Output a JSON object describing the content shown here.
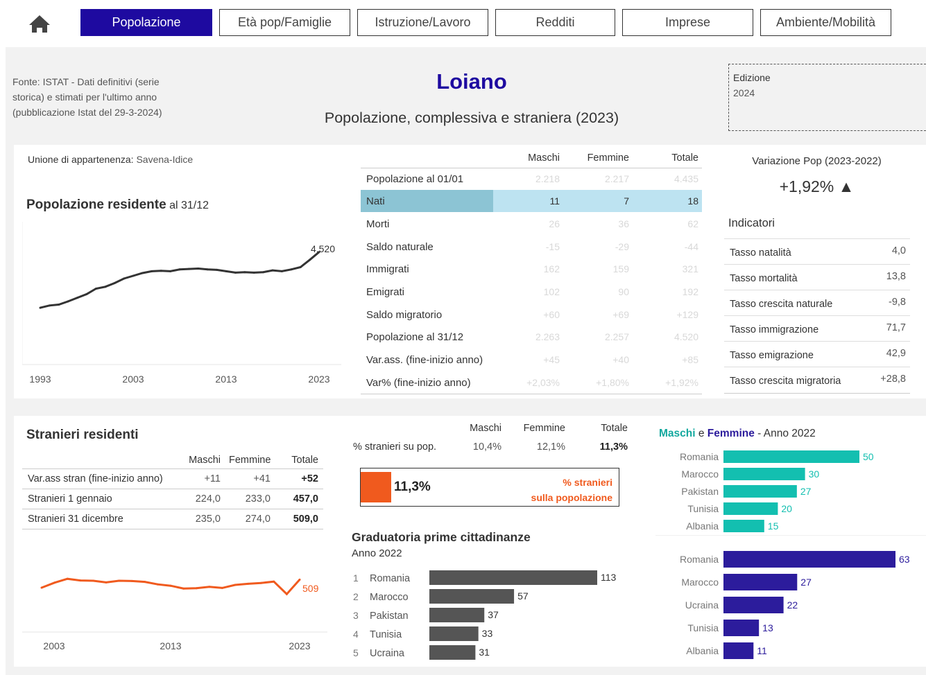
{
  "nav": {
    "tabs": [
      {
        "label": "Popolazione",
        "active": true
      },
      {
        "label": "Età pop/Famiglie"
      },
      {
        "label": "Istruzione/Lavoro"
      },
      {
        "label": "Redditi"
      },
      {
        "label": "Imprese"
      },
      {
        "label": "Ambiente/Mobilità"
      }
    ],
    "home_icon": "home-icon"
  },
  "header": {
    "source": "Fonte: ISTAT - Dati definitivi (serie storica) e stimati per l'ultimo anno (pubblicazione Istat del 29-3-2024)",
    "title": "Loiano",
    "subtitle": "Popolazione, complessiva e straniera (2023)",
    "edition_label": "Edizione",
    "edition_value": "2024"
  },
  "union": {
    "label": "Unione di appartenenza:",
    "value": "Savena-Idice"
  },
  "pop_chart": {
    "title_bold": "Popolazione residente",
    "title_light": " al 31/12",
    "end_label": "4.520",
    "ticks": [
      "1993",
      "2003",
      "2013",
      "2023"
    ]
  },
  "main_table": {
    "headers": [
      "Maschi",
      "Femmine",
      "Totale"
    ],
    "rows": [
      {
        "label": "Popolazione al 01/01",
        "m": "2.218",
        "f": "2.217",
        "t": "4.435"
      },
      {
        "label": "Nati",
        "m": "11",
        "f": "7",
        "t": "18",
        "highlight": true
      },
      {
        "label": "Morti",
        "m": "26",
        "f": "36",
        "t": "62"
      },
      {
        "label": "Saldo naturale",
        "m": "-15",
        "f": "-29",
        "t": "-44"
      },
      {
        "label": "Immigrati",
        "m": "162",
        "f": "159",
        "t": "321"
      },
      {
        "label": "Emigrati",
        "m": "102",
        "f": "90",
        "t": "192"
      },
      {
        "label": "Saldo migratorio",
        "m": "+60",
        "f": "+69",
        "t": "+129"
      },
      {
        "label": "Popolazione al 31/12",
        "m": "2.263",
        "f": "2.257",
        "t": "4.520"
      },
      {
        "label": "Var.ass. (fine-inizio anno)",
        "m": "+45",
        "f": "+40",
        "t": "+85"
      },
      {
        "label": "Var% (fine-inizio anno)",
        "m": "+2,03%",
        "f": "+1,80%",
        "t": "+1,92%"
      }
    ]
  },
  "variation": {
    "title": "Variazione Pop (2023-2022)",
    "value": "+1,92% ▲"
  },
  "indicators": {
    "title": "Indicatori",
    "rows": [
      {
        "label": "Tasso natalità",
        "value": "4,0"
      },
      {
        "label": "Tasso mortalità",
        "value": "13,8"
      },
      {
        "label": "Tasso crescita naturale",
        "value": "-9,8"
      },
      {
        "label": "Tasso immigrazione",
        "value": "71,7"
      },
      {
        "label": "Tasso emigrazione",
        "value": "42,9"
      },
      {
        "label": "Tasso crescita migratoria",
        "value": "+28,8"
      }
    ]
  },
  "stranieri": {
    "title": "Stranieri residenti",
    "headers": [
      "Maschi",
      "Femmine",
      "Totale"
    ],
    "rows": [
      {
        "label": "Var.ass stran (fine-inizio anno)",
        "m": "+11",
        "f": "+41",
        "t": "+52"
      },
      {
        "label": "Stranieri 1 gennaio",
        "m": "224,0",
        "f": "233,0",
        "t": "457,0"
      },
      {
        "label": "Stranieri 31 dicembre",
        "m": "235,0",
        "f": "274,0",
        "t": "509,0"
      }
    ],
    "chart_end_label": "509",
    "ticks": [
      "2003",
      "2013",
      "2023"
    ]
  },
  "pct_stranieri": {
    "headers": [
      "Maschi",
      "Femmine",
      "Totale"
    ],
    "label": "% stranieri su pop.",
    "m": "10,4%",
    "f": "12,1%",
    "t": "11,3%",
    "kpi_value": "11,3%",
    "kpi_label_1": "% stranieri",
    "kpi_label_2": "sulla popolazione",
    "accent": "#f05a1e"
  },
  "graduatoria": {
    "title": "Graduatoria prime cittadinanze",
    "subtitle": "Anno 2022"
  },
  "mf_legend": {
    "m": "Maschi",
    "sep": " e ",
    "f": "Femmine",
    "tail": " - Anno 2022"
  },
  "chart_data": [
    {
      "type": "line",
      "title": "Popolazione residente al 31/12",
      "x": [
        1993,
        1994,
        1995,
        1996,
        1997,
        1998,
        1999,
        2000,
        2001,
        2002,
        2003,
        2004,
        2005,
        2006,
        2007,
        2008,
        2009,
        2010,
        2011,
        2012,
        2013,
        2014,
        2015,
        2016,
        2017,
        2018,
        2019,
        2020,
        2021,
        2022,
        2023
      ],
      "y": [
        3910,
        3935,
        3945,
        3980,
        4020,
        4060,
        4120,
        4140,
        4180,
        4230,
        4260,
        4290,
        4310,
        4315,
        4310,
        4330,
        4335,
        4340,
        4330,
        4325,
        4310,
        4295,
        4300,
        4295,
        4300,
        4320,
        4310,
        4330,
        4355,
        4435,
        4520
      ],
      "ylim": [
        3600,
        4700
      ],
      "color": "#333333"
    },
    {
      "type": "line",
      "title": "Stranieri residenti",
      "x": [
        2003,
        2004,
        2005,
        2006,
        2007,
        2008,
        2009,
        2010,
        2011,
        2012,
        2013,
        2014,
        2015,
        2016,
        2017,
        2018,
        2019,
        2020,
        2021,
        2022,
        2023
      ],
      "y": [
        480,
        498,
        512,
        506,
        505,
        499,
        505,
        504,
        501,
        492,
        487,
        477,
        478,
        483,
        479,
        490,
        494,
        497,
        502,
        457,
        509
      ],
      "ylim": [
        300,
        600
      ],
      "color": "#f05a1e"
    },
    {
      "type": "bar",
      "title": "Graduatoria prime cittadinanze",
      "categories": [
        "Romania",
        "Marocco",
        "Pakistan",
        "Tunisia",
        "Ucraina"
      ],
      "ranks": [
        "1",
        "2",
        "3",
        "4",
        "5"
      ],
      "values": [
        113,
        57,
        37,
        33,
        31
      ],
      "color": "#555555"
    },
    {
      "type": "bar",
      "title": "Maschi",
      "categories": [
        "Romania",
        "Marocco",
        "Pakistan",
        "Tunisia",
        "Albania"
      ],
      "values": [
        50,
        30,
        27,
        20,
        15
      ],
      "color": "#13bfb0"
    },
    {
      "type": "bar",
      "title": "Femmine",
      "categories": [
        "Romania",
        "Marocco",
        "Ucraina",
        "Tunisia",
        "Albania"
      ],
      "values": [
        63,
        27,
        22,
        13,
        11
      ],
      "color": "#2c1c9c"
    }
  ]
}
